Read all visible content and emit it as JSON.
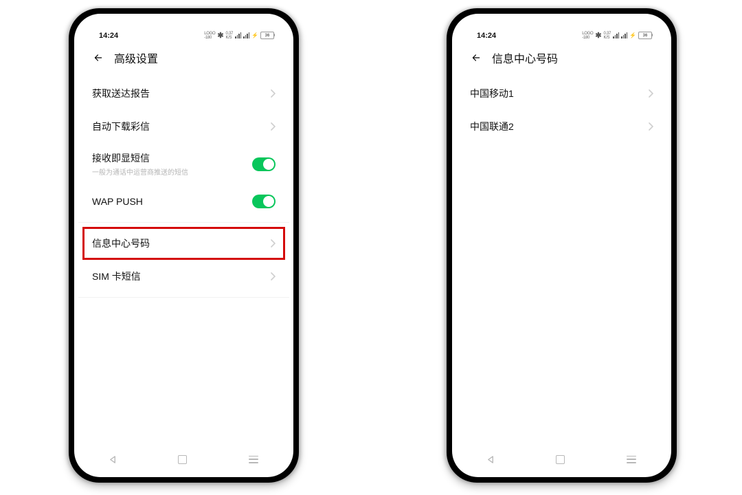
{
  "status": {
    "time": "14:24",
    "net_left": "0.37",
    "battery": "36"
  },
  "phones": [
    {
      "title": "高级设置",
      "rows": [
        {
          "label": "获取送达报告",
          "type": "nav"
        },
        {
          "label": "自动下载彩信",
          "type": "nav"
        },
        {
          "label": "接收即显短信",
          "sub": "一般为通话中运营商推送的短信",
          "type": "toggle"
        },
        {
          "label": "WAP PUSH",
          "type": "toggle"
        },
        {
          "divider": true
        },
        {
          "label": "信息中心号码",
          "type": "nav",
          "highlight": true
        },
        {
          "label": "SIM 卡短信",
          "type": "nav"
        },
        {
          "divider": true
        }
      ]
    },
    {
      "title": "信息中心号码",
      "rows": [
        {
          "label": "中国移动1",
          "type": "nav"
        },
        {
          "label": "中国联通2",
          "type": "nav"
        }
      ]
    }
  ]
}
